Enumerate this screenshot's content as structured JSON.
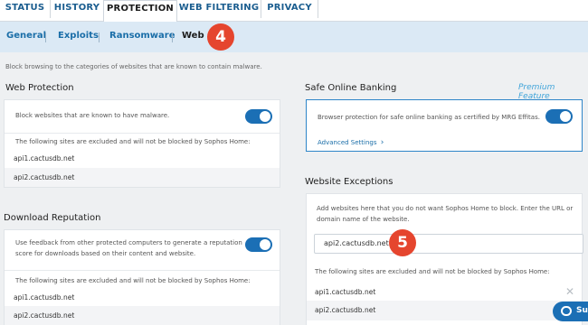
{
  "top_tabs": [
    {
      "label": "STATUS"
    },
    {
      "label": "HISTORY"
    },
    {
      "label": "PROTECTION"
    },
    {
      "label": "WEB FILTERING"
    },
    {
      "label": "PRIVACY"
    }
  ],
  "sub_tabs": [
    {
      "label": "General"
    },
    {
      "label": "Exploits"
    },
    {
      "label": "Ransomware"
    },
    {
      "label": "Web"
    }
  ],
  "badges": {
    "step4": "4",
    "step5": "5"
  },
  "intro": "Block browsing to the categories of websites that are known to contain malware.",
  "web_protection": {
    "title": "Web Protection",
    "option_label": "Block websites that are known to have malware.",
    "toggle_on": true,
    "excluded_text": "The following sites are excluded and will not be blocked by Sophos Home:",
    "sites": [
      "api1.cactusdb.net",
      "api2.cactusdb.net"
    ]
  },
  "download_reputation": {
    "title": "Download Reputation",
    "option_label_line1": "Use feedback from other protected computers to generate a reputation",
    "option_label_line2": "score for downloads based on their content and website.",
    "toggle_on": true,
    "excluded_text": "The following sites are excluded and will not be blocked by Sophos Home:",
    "sites": [
      "api1.cactusdb.net",
      "api2.cactusdb.net"
    ]
  },
  "safe_banking": {
    "title": "Safe Online Banking",
    "premium_label": "Premium Feature",
    "option_label": "Browser protection for safe online banking as certified by MRG Effitas.",
    "toggle_on": true,
    "advanced_label": "Advanced Settings",
    "chevron": "›"
  },
  "website_exceptions": {
    "title": "Website Exceptions",
    "help_line1": "Add websites here that you do not want Sophos Home to block. Enter the URL or",
    "help_line2": "domain name of the website.",
    "input_value": "api2.cactusdb.net",
    "excluded_text": "The following sites are excluded and will not be blocked by Sophos Home:",
    "sites": [
      "api1.cactusdb.net",
      "api2.cactusdb.net"
    ],
    "remove_icon": "✕"
  },
  "chat": {
    "label": "Su"
  },
  "colors": {
    "accent": "#1b6fb5",
    "badge": "#e5452e",
    "premium": "#3ea3d9",
    "subbar": "#dbe9f5"
  }
}
